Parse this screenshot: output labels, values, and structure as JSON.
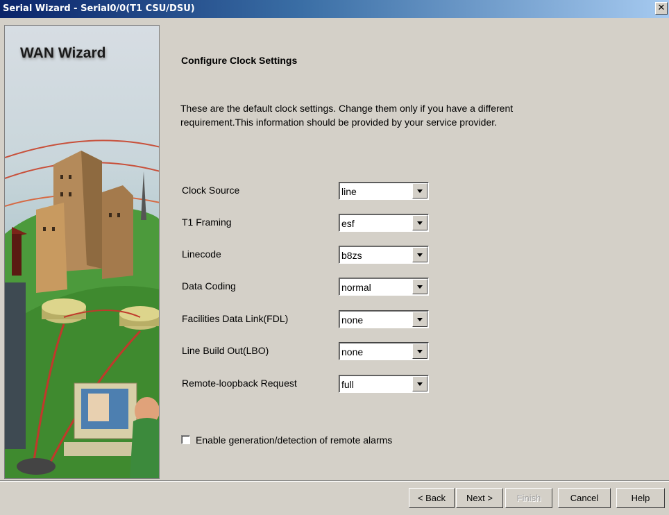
{
  "window": {
    "title": "Serial Wizard - Serial0/0(T1 CSU/DSU)",
    "close_label": "✕"
  },
  "left_panel": {
    "title": "WAN Wizard"
  },
  "main": {
    "heading": "Configure Clock Settings",
    "description": "These are the default clock settings. Change them only if you have a different requirement.This information should be provided by your service provider."
  },
  "fields": [
    {
      "label": "Clock Source",
      "value": "line"
    },
    {
      "label": "T1 Framing",
      "value": "esf"
    },
    {
      "label": "Linecode",
      "value": "b8zs"
    },
    {
      "label": "Data Coding",
      "value": "normal"
    },
    {
      "label": "Facilities Data Link(FDL)",
      "value": "none"
    },
    {
      "label": "Line Build Out(LBO)",
      "value": "none"
    },
    {
      "label": "Remote-loopback Request",
      "value": "full"
    }
  ],
  "alarms_checkbox": {
    "label": "Enable generation/detection of remote alarms",
    "checked": false
  },
  "buttons": {
    "back": "< Back",
    "next": "Next >",
    "finish": "Finish",
    "cancel": "Cancel",
    "help": "Help"
  }
}
